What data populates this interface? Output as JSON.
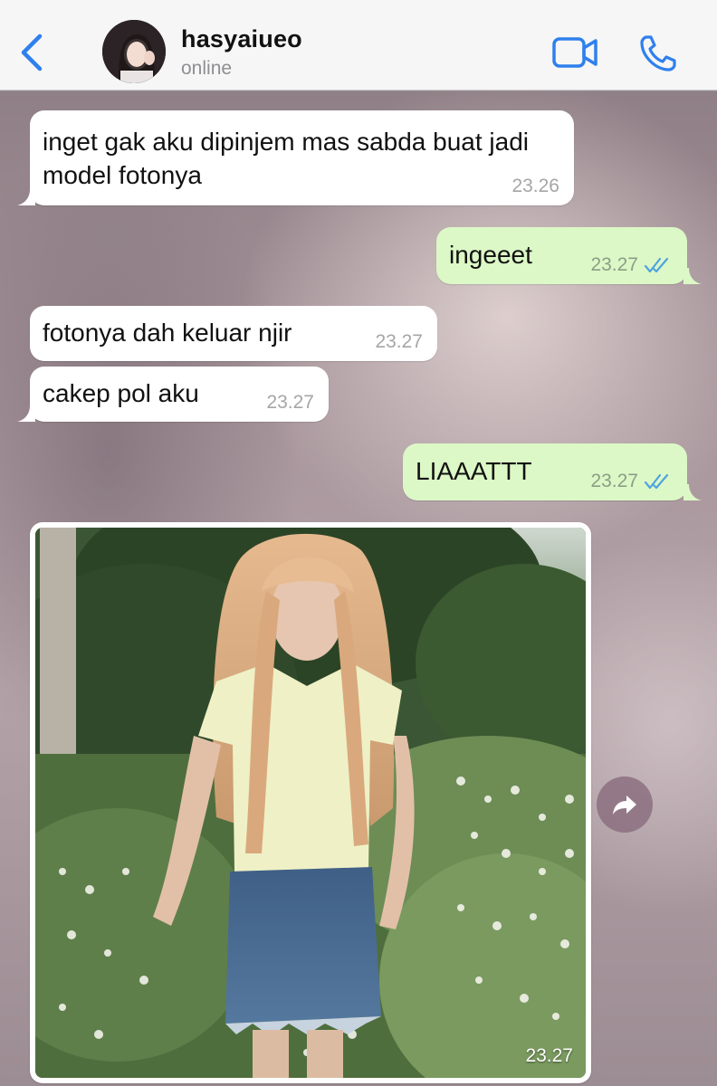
{
  "header": {
    "contact_name": "hasyaiueo",
    "status": "online",
    "icons": {
      "back": "chevron-left-icon",
      "video": "video-camera-icon",
      "call": "phone-icon"
    },
    "accent_color": "#2f80ed"
  },
  "messages": [
    {
      "direction": "in",
      "text": "inget gak aku dipinjem mas sabda buat jadi model fotonya",
      "time": "23.26"
    },
    {
      "direction": "out",
      "text": "ingeeet",
      "time": "23.27",
      "status": "read"
    },
    {
      "direction": "in",
      "text": "fotonya dah keluar njir",
      "time": "23.27"
    },
    {
      "direction": "in",
      "text": "cakep pol aku",
      "time": "23.27"
    },
    {
      "direction": "out",
      "text": "LIAAATTT",
      "time": "23.27",
      "status": "read"
    },
    {
      "direction": "in",
      "type": "image",
      "time": "23.27",
      "icon": "photo-of-girl-in-flower-field"
    }
  ],
  "colors": {
    "incoming_bubble": "#ffffff",
    "outgoing_bubble": "#dcf8c6",
    "read_ticks": "#4fa3e0"
  }
}
